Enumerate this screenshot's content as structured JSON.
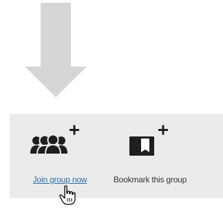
{
  "panel": {
    "join_group": {
      "label": "Join group now",
      "icon": "users-add-icon",
      "link_color": "#2a6ea5"
    },
    "bookmark_group": {
      "label": "Bookmark this group",
      "icon": "bookmark-add-icon"
    }
  },
  "indicator": {
    "icon": "down-arrow-icon",
    "color": "#d6d6d6"
  },
  "cursor": {
    "icon": "hand-pointer-icon"
  },
  "colors": {
    "panel_background": "#ebebeb",
    "icon_dark": "#1f1f1f",
    "text": "#333333"
  }
}
